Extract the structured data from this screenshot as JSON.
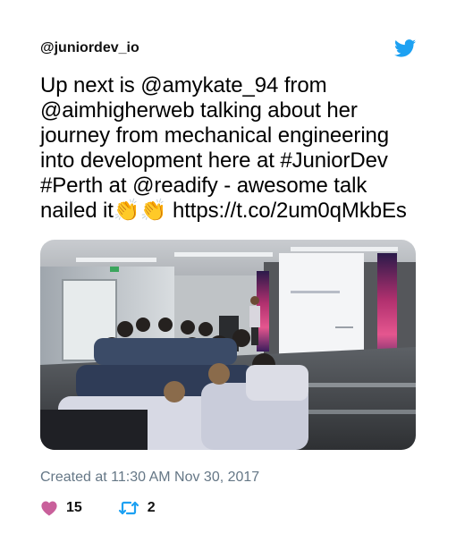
{
  "tweet": {
    "handle": "@juniordev_io",
    "text": "Up next is @amykate_94 from @aimhigherweb talking about her journey from mechanical engineering into development here at #JuniorDev #Perth at @readify - awesome talk nailed it👏👏 https://t.co/2um0qMkbEs",
    "timestamp": "Created at 11:30 AM Nov 30, 2017",
    "likes": "15",
    "retweets": "2"
  },
  "icons": {
    "brand": "twitter-bird-icon",
    "like": "heart-icon",
    "retweet": "retweet-icon"
  },
  "colors": {
    "twitter_blue": "#1da1f2",
    "like_pink": "#e0245e",
    "timestamp_gray": "#657786"
  }
}
